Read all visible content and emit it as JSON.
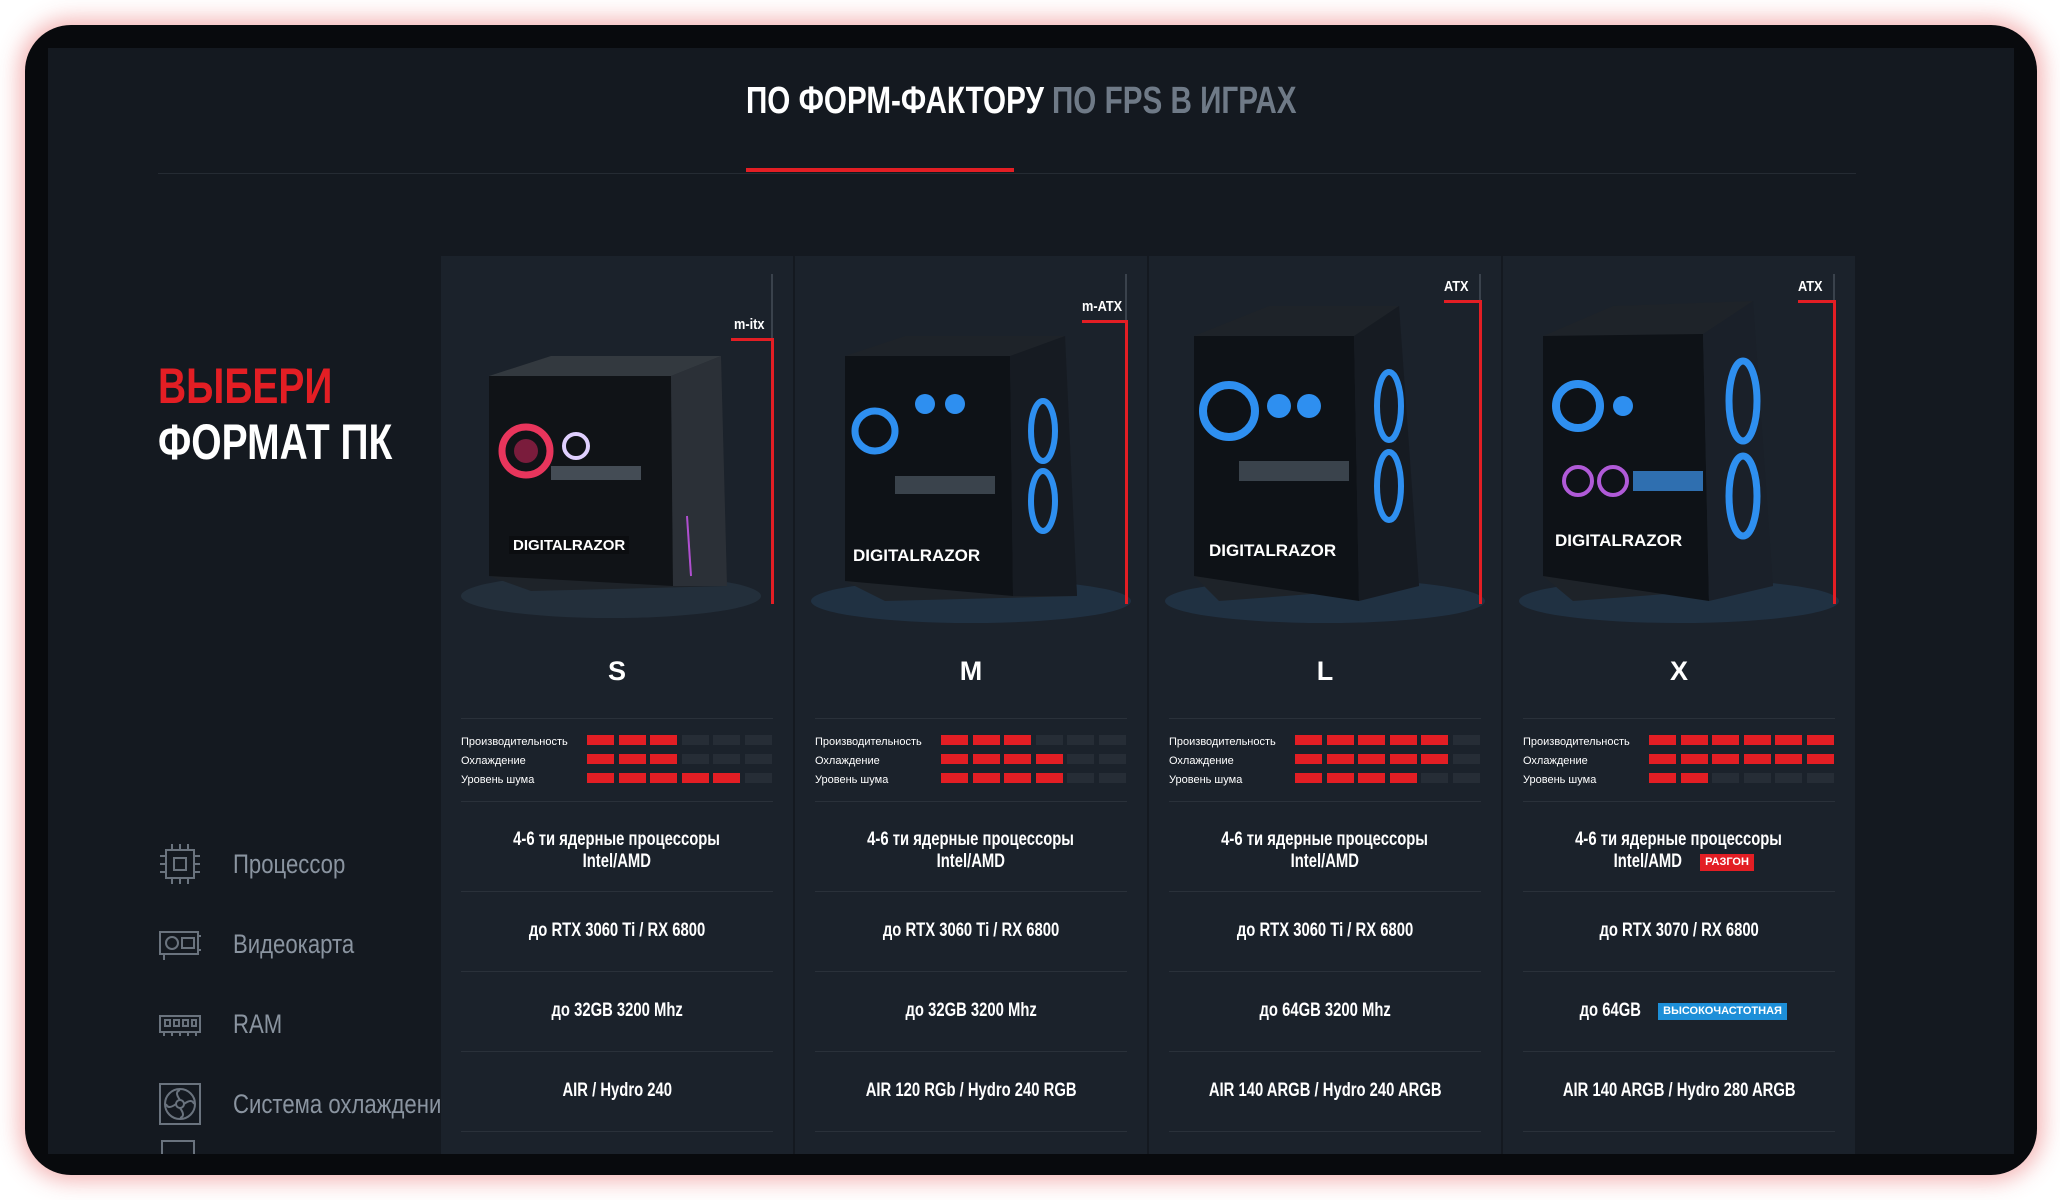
{
  "tabs": {
    "active": "ПО ФОРМ-ФАКТОРУ",
    "inactive": "ПО FPS В ИГРАХ"
  },
  "headline": {
    "line1": "ВЫБЕРИ",
    "line2": "ФОРМАТ ПК"
  },
  "spec_labels": {
    "cpu": "Процессор",
    "gpu": "Видеокарта",
    "ram": "RAM",
    "cooling": "Система охлаждения"
  },
  "rating_labels": {
    "performance": "Производительность",
    "cooling": "Охлаждение",
    "noise": "Уровень шума"
  },
  "cards": [
    {
      "size": "S",
      "form": "m-itx",
      "brand": "DIGITALRAZOR",
      "ratings": {
        "performance": 3,
        "cooling": 3,
        "noise": 5
      },
      "cpu_line1": "4-6 ти ядерные процессоры",
      "cpu_line2": "Intel/AMD",
      "cpu_badge": "",
      "gpu": "до RTX 3060 Ti / RX 6800",
      "ram": "до 32GB 3200 Mhz",
      "ram_badge": "",
      "cooling": "AIR / Hydro 240"
    },
    {
      "size": "M",
      "form": "m-ATX",
      "brand": "DIGITALRAZOR",
      "ratings": {
        "performance": 3,
        "cooling": 4,
        "noise": 4
      },
      "cpu_line1": "4-6 ти ядерные процессоры",
      "cpu_line2": "Intel/AMD",
      "cpu_badge": "",
      "gpu": "до RTX 3060 Ti / RX 6800",
      "ram": "до 32GB 3200 Mhz",
      "ram_badge": "",
      "cooling": "AIR 120 RGb / Hydro 240 RGB"
    },
    {
      "size": "L",
      "form": "ATX",
      "brand": "DIGITALRAZOR",
      "ratings": {
        "performance": 5,
        "cooling": 5,
        "noise": 4
      },
      "cpu_line1": "4-6 ти ядерные процессоры",
      "cpu_line2": "Intel/AMD",
      "cpu_badge": "",
      "gpu": "до RTX 3060 Ti / RX 6800",
      "ram": "до 64GB 3200 Mhz",
      "ram_badge": "",
      "cooling": "AIR 140 ARGB / Hydro 240 ARGB"
    },
    {
      "size": "X",
      "form": "ATX",
      "brand": "DIGITALRAZOR",
      "ratings": {
        "performance": 6,
        "cooling": 6,
        "noise": 2
      },
      "cpu_line1": "4-6 ти ядерные процессоры",
      "cpu_line2": "Intel/AMD",
      "cpu_badge": "РАЗГОН",
      "gpu": "до RTX 3070 / RX 6800",
      "ram": "до 64GB",
      "ram_badge": "ВЫСОКОЧАСТОТНАЯ",
      "cooling": "AIR 140 ARGB / Hydro 280 ARGB"
    }
  ],
  "colors": {
    "accent": "#e31e24",
    "badge_blue": "#1d8fd8",
    "background": "#141920",
    "card": "#1b222b"
  }
}
